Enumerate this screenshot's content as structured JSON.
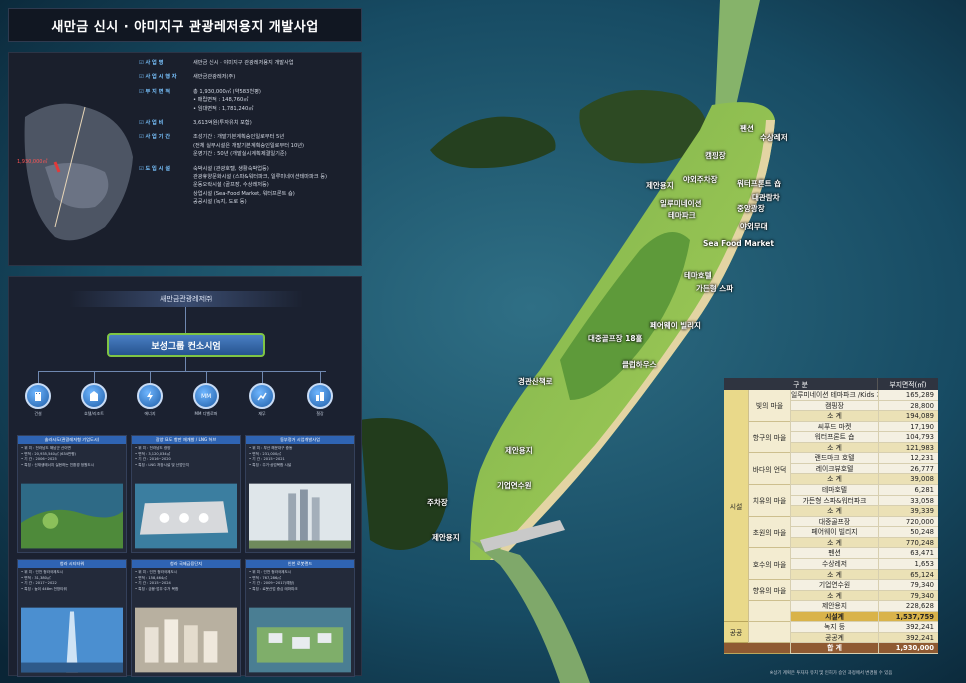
{
  "title": "새만금 신시 · 야미지구 관광레저용지 개발사업",
  "mini_map": {
    "marker": "1,930,000㎡"
  },
  "info": [
    {
      "label": "사   업   명",
      "lines": [
        "새만금 신시 · 야미지구 관광레저용지 개발사업"
      ]
    },
    {
      "label": "사 업 시 행 자",
      "lines": [
        "새만금관광레저(주)"
      ]
    },
    {
      "label": "부 지 면 적",
      "lines": [
        "총 1,930,000㎡ (약583천평)",
        "• 매립면적 : 148,760㎡",
        "• 임대면적 : 1,781,240㎡"
      ]
    },
    {
      "label": "사   업   비",
      "lines": [
        "3,613억원(투자유치 포함)"
      ]
    },
    {
      "label": "사 업 기 간",
      "lines": [
        "조성기간 : 개발기본계획승인일로부터 5년",
        "(전체 실부시설은 개발기본계획승인일로부터 10년)",
        "운영기간 : 50년 (개발실시계획제결일기준)"
      ]
    },
    {
      "label": "도 입 시 설",
      "lines": [
        "숙박시설 (관광호텔, 생활숙박업등)",
        "관광휴양문화시설 (스파&워터파크, 일루미네이션테마파크 등)",
        "운동오락시설 (골프장, 수상레저등)",
        "상업시설 (Sea-Food Market, 워터프론트 숍)",
        "공공시설 (녹지, 도로 등)"
      ]
    }
  ],
  "org": {
    "top": "새만금관광레저㈜",
    "main": "보성그룹 컨소시엄",
    "members": [
      {
        "icon": "building-icon",
        "label": "건설"
      },
      {
        "icon": "hotel-icon",
        "label": "호텔/리조트"
      },
      {
        "icon": "energy-icon",
        "label": "에너지"
      },
      {
        "icon": "mm-icon",
        "label": "MM 디벨로퍼",
        "badge": "MM"
      },
      {
        "icon": "finance-icon",
        "label": "재무"
      },
      {
        "icon": "city-icon",
        "label": "철강"
      }
    ]
  },
  "cards": [
    {
      "title": "솔라시도(관광레저형 기업도시)",
      "lines": [
        "• 위 치 : 전라남도 해남군 산이면",
        "• 면적 : 20,935,540㎡ (634만평)",
        "• 기 간 : 2006~2025",
        "• 특징 : 신재생에너지 실현하는 친환경 정원도시"
      ]
    },
    {
      "title": "광양 묘도 항만 재개발 / LNG 허브",
      "lines": [
        "• 위 치 : 전라남도 광양",
        "• 면적 : 3,120,034㎡",
        "• 기 간 : 2016~2020",
        "• 특징 : LNG 저장시설 및 산업단지"
      ]
    },
    {
      "title": "동부정거 시업개발사업",
      "lines": [
        "• 위 치 : 부산 해운대구 중동",
        "• 면적 : 231,000㎡",
        "• 기 간 : 2015~2021",
        "• 특징 : 주거·상업복합 시설"
      ]
    },
    {
      "title": "청라 시티타워",
      "lines": [
        "• 위 치 : 인천 청라국제도시",
        "• 면적 : 31,380㎡",
        "• 기 간 : 2017~2022",
        "• 특징 : 높이 448m 전망타워"
      ]
    },
    {
      "title": "청라 국제금융단지",
      "lines": [
        "• 위 치 : 인천 청라국제도시",
        "• 면적 : 158,464㎡",
        "• 기 간 : 2015~2024",
        "• 특징 : 금융·업무·주거 복합"
      ]
    },
    {
      "title": "인천 로봇랜드",
      "lines": [
        "• 위 치 : 인천 청라국제도시",
        "• 면적 : 767,286㎡",
        "• 기 간 : 2009~2017(예정)",
        "• 특징 : 로봇산업 중심 테마파크"
      ]
    }
  ],
  "map_labels": [
    "펜션",
    "수상레저",
    "캠핑장",
    "제안용지",
    "야외주차장",
    "워터프론트 숍",
    "대관람차",
    "일루미네이션",
    "테마파크",
    "중앙광장",
    "야외무대",
    "Sea Food Market",
    "테마호텔",
    "가든형 스파",
    "페어웨이 빌리지",
    "대중골프장 18홀",
    "클럽하우스",
    "경관산책로",
    "제안용지",
    "기업연수원",
    "주차장",
    "제안용지"
  ],
  "table": {
    "headers": [
      "구 분",
      "부지면적(㎡)"
    ],
    "rows": [
      {
        "name": "일루미네이션 테마파크 /Kids 가든",
        "value": "165,289"
      },
      {
        "name": "캠핑장",
        "value": "28,800"
      },
      {
        "name": "소 계",
        "value": "194,089",
        "kind": "sub"
      },
      {
        "name": "씨푸드 마켓",
        "value": "17,190"
      },
      {
        "name": "워터프론트 숍",
        "value": "104,793"
      },
      {
        "name": "소 계",
        "value": "121,983",
        "kind": "sub"
      },
      {
        "name": "랜드마크 호텔",
        "value": "12,231"
      },
      {
        "name": "레이크뷰호텔",
        "value": "26,777"
      },
      {
        "name": "소 계",
        "value": "39,008",
        "kind": "sub"
      },
      {
        "name": "테마호텔",
        "value": "6,281"
      },
      {
        "name": "가든형 스파&워터파크",
        "value": "33,058"
      },
      {
        "name": "소 계",
        "value": "39,339",
        "kind": "sub"
      },
      {
        "name": "대중골프장",
        "value": "720,000"
      },
      {
        "name": "페어웨이 빌리지",
        "value": "50,248"
      },
      {
        "name": "소 계",
        "value": "770,248",
        "kind": "sub"
      },
      {
        "name": "펜션",
        "value": "63,471"
      },
      {
        "name": "수상레저",
        "value": "1,653"
      },
      {
        "name": "소 계",
        "value": "65,124",
        "kind": "sub"
      },
      {
        "name": "기업연수원",
        "value": "79,340"
      },
      {
        "name": "소 계",
        "value": "79,340",
        "kind": "sub"
      },
      {
        "name": "제안용지",
        "value": "228,628"
      },
      {
        "name": "시설계",
        "value": "1,537,759",
        "kind": "tot"
      },
      {
        "name": "녹지 등",
        "value": "392,241"
      },
      {
        "name": "공공계",
        "value": "392,241",
        "kind": "sub"
      },
      {
        "name": "합 계",
        "value": "1,930,000",
        "kind": "grand"
      }
    ],
    "groups": [
      {
        "label": "빛의 마을",
        "from": 0,
        "span": 3
      },
      {
        "label": "항구의 마을",
        "from": 3,
        "span": 3
      },
      {
        "label": "바다의 언덕",
        "from": 6,
        "span": 3
      },
      {
        "label": "치유의 마을",
        "from": 9,
        "span": 3
      },
      {
        "label": "초원의 마을",
        "from": 12,
        "span": 3
      },
      {
        "label": "호수의 마을",
        "from": 15,
        "span": 3
      },
      {
        "label": "향유의 마을",
        "from": 18,
        "span": 2
      },
      {
        "label": "",
        "from": 20,
        "span": 2
      }
    ],
    "categories": [
      {
        "label": "시설",
        "from": 0,
        "span": 22
      },
      {
        "label": "공공",
        "from": 22,
        "span": 2
      }
    ],
    "note": "※상기 계획은 투자자 유치 및 인허가 승인 과정에서 변경될 수 있음"
  }
}
